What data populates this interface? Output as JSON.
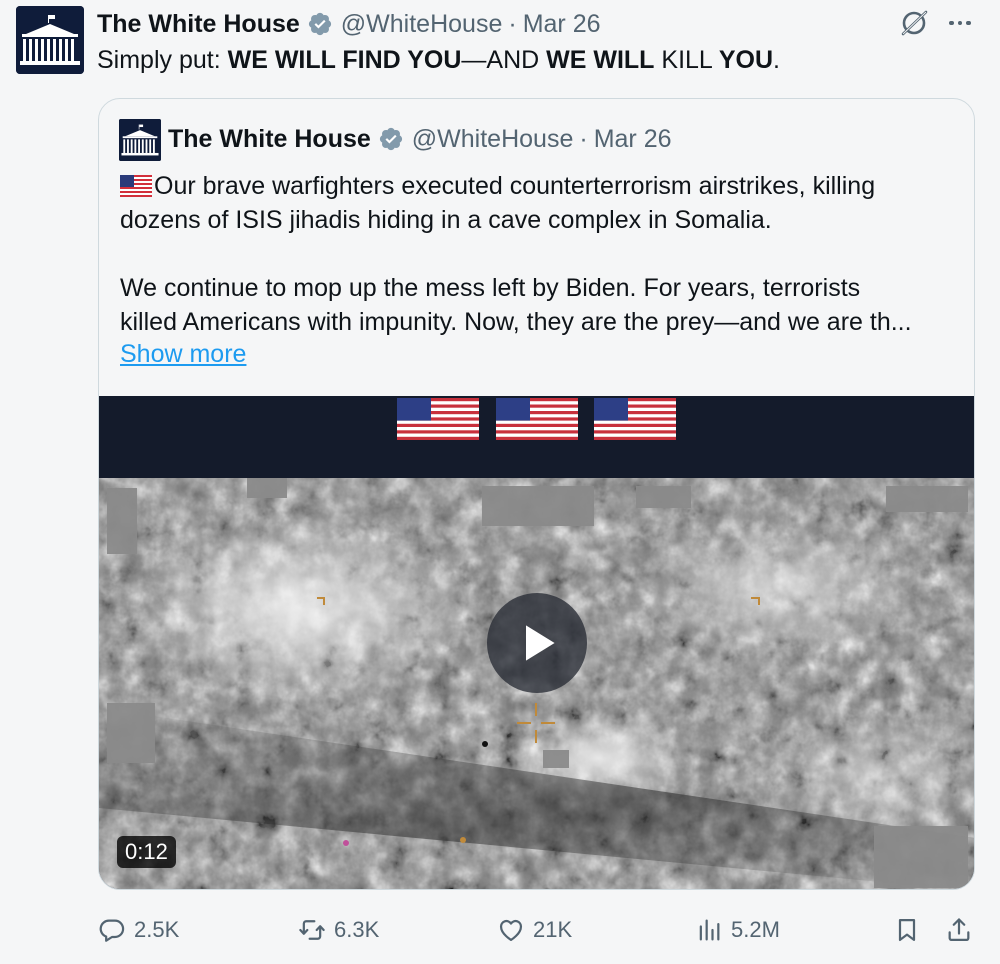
{
  "tweet": {
    "author_name": "The White House",
    "handle": "@WhiteHouse",
    "separator": "·",
    "date": "Mar 26",
    "text": {
      "part1": "Simply put: ",
      "part2": "WE WILL FIND YOU",
      "part3": "—AND ",
      "part4": "WE WILL",
      "part5": " KILL ",
      "part6": "YOU",
      "part7": "."
    }
  },
  "quoted_tweet": {
    "author_name": "The White House",
    "handle": "@WhiteHouse",
    "separator": "·",
    "date": "Mar 26",
    "line1": "Our brave warfighters executed counterterrorism airstrikes, killing",
    "line2": "dozens of ISIS jihadis hiding in a cave complex in Somalia.",
    "line3": "We continue to mop up the mess left by Biden. For years, terrorists",
    "line4": "killed Americans with impunity. Now, they are the prey—and we are th...",
    "show_more": "Show more",
    "video": {
      "duration": "0:12"
    }
  },
  "actions": {
    "replies": "2.5K",
    "reposts": "6.3K",
    "likes": "21K",
    "views": "5.2M"
  },
  "colors": {
    "link": "#1d9bf0",
    "muted": "#536471",
    "verified_gray": "#829aab",
    "avatar_navy": "#0f1c3a"
  },
  "icons": {
    "reply": "speech-bubble",
    "repost": "repost-arrows",
    "like": "heart",
    "views": "bar-chart",
    "bookmark": "bookmark",
    "share": "upload-arrow",
    "grok": "grok-slash-circle",
    "more": "three-dots",
    "verified": "verified-badge"
  }
}
